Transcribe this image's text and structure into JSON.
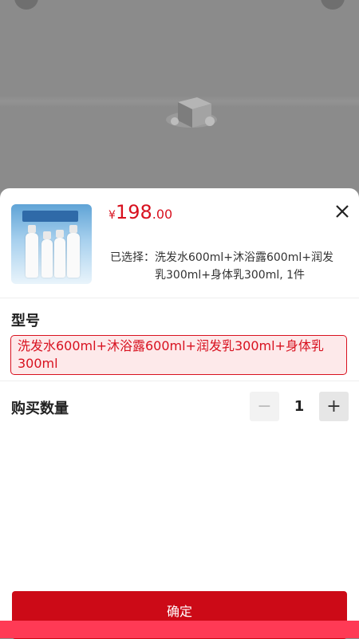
{
  "backdrop": {
    "left_button_icon": "circle-button-icon",
    "right_button_icon": "circle-button-icon",
    "placeholder_icon": "package-box-icon"
  },
  "product": {
    "image_alt": "product-image",
    "price_symbol": "¥",
    "price_integer": "198",
    "price_decimal": ".00",
    "selected_label": "已选择：",
    "selected_value": "洗发水600ml+沐浴露600ml+润发乳300ml+身体乳300ml, 1件",
    "close_icon": "close-icon"
  },
  "variant": {
    "title": "型号",
    "options": [
      {
        "label": "洗发水600ml+沐浴露600ml+润发乳300ml+身体乳300ml",
        "selected": true
      }
    ]
  },
  "quantity": {
    "title": "购买数量",
    "minus_label": "−",
    "value": "1",
    "plus_label": "+"
  },
  "actions": {
    "confirm_label": "确定"
  },
  "colors": {
    "accent": "#d8111f",
    "button": "#cc0a17",
    "bottom_bar": "#ff3a55"
  }
}
